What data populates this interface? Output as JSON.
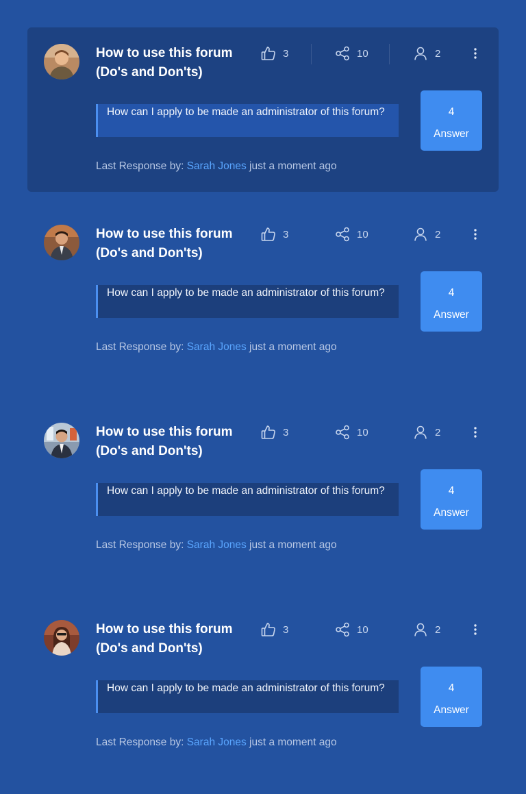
{
  "colors": {
    "background": "#2352a0",
    "highlight_card": "#1d4282",
    "accent": "#3f8cf0",
    "link": "#5aa6ff"
  },
  "posts": [
    {
      "title_line1": "How to use this forum",
      "title_line2": "(Do's and Don'ts)",
      "likes": "3",
      "shares": "10",
      "participants": "2",
      "question": "How can I apply to be made an administrator of this forum?",
      "answers_count": "4",
      "answers_label": "Answer",
      "last_response_label": "Last Response by:",
      "last_response_user": "Sarah Jones",
      "last_response_time": "just a moment ago",
      "icons": {
        "likes": "thumbs-up-icon",
        "shares": "share-icon",
        "participants": "user-icon",
        "more": "more-vertical-icon"
      }
    },
    {
      "title_line1": "How to use this forum",
      "title_line2": "(Do's and Don'ts)",
      "likes": "3",
      "shares": "10",
      "participants": "2",
      "question": "How can I apply to be made an administrator of this forum?",
      "answers_count": "4",
      "answers_label": "Answer",
      "last_response_label": "Last Response by:",
      "last_response_user": "Sarah Jones",
      "last_response_time": "just a moment ago",
      "icons": {
        "likes": "thumbs-up-icon",
        "shares": "share-icon",
        "participants": "user-icon",
        "more": "more-vertical-icon"
      }
    },
    {
      "title_line1": "How to use this forum",
      "title_line2": "(Do's and Don'ts)",
      "likes": "3",
      "shares": "10",
      "participants": "2",
      "question": "How can I apply to be made an administrator of this forum?",
      "answers_count": "4",
      "answers_label": "Answer",
      "last_response_label": "Last Response by:",
      "last_response_user": "Sarah Jones",
      "last_response_time": "just a moment ago",
      "icons": {
        "likes": "thumbs-up-icon",
        "shares": "share-icon",
        "participants": "user-icon",
        "more": "more-vertical-icon"
      }
    },
    {
      "title_line1": "How to use this forum",
      "title_line2": "(Do's and Don'ts)",
      "likes": "3",
      "shares": "10",
      "participants": "2",
      "question": "How can I apply to be made an administrator of this forum?",
      "answers_count": "4",
      "answers_label": "Answer",
      "last_response_label": "Last Response by:",
      "last_response_user": "Sarah Jones",
      "last_response_time": "just a moment ago",
      "icons": {
        "likes": "thumbs-up-icon",
        "shares": "share-icon",
        "participants": "user-icon",
        "more": "more-vertical-icon"
      }
    }
  ]
}
